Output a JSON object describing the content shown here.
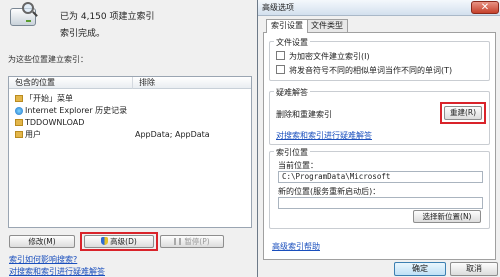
{
  "left": {
    "count_text": "已为 4,150 项建立索引",
    "status_text": "索引完成。",
    "index_caption": "为这些位置建立索引：",
    "table": {
      "col_included": "包含的位置",
      "col_excluded": "排除",
      "rows": [
        {
          "name": "「开始」菜单",
          "excluded": ""
        },
        {
          "name": "Internet Explorer 历史记录",
          "excluded": ""
        },
        {
          "name": "TDDOWNLOAD",
          "excluded": ""
        },
        {
          "name": "用户",
          "excluded": "AppData; AppData"
        }
      ]
    },
    "buttons": {
      "modify": "修改(M)",
      "advanced": "高级(D)",
      "pause": "暂停(P)"
    },
    "links": {
      "search_help": "索引如何影响搜索?",
      "troubleshoot": "对搜索和索引进行疑难解答"
    }
  },
  "dialog": {
    "title": "高级选项",
    "close_glyph": "✕",
    "tabs": [
      "索引设置",
      "文件类型"
    ],
    "file_settings": {
      "title": "文件设置",
      "options": [
        "为加密文件建立索引(I)",
        "将发音符号不同的相似单词当作不同的单词(T)"
      ]
    },
    "troubleshoot": {
      "title": "疑难解答",
      "label": "删除和重建索引",
      "rebuild": "重建(R)",
      "link": "对搜索和索引进行疑难解答"
    },
    "index_location": {
      "title": "索引位置",
      "current_label": "当前位置：",
      "current_path": "C:\\ProgramData\\Microsoft",
      "new_label": "新的位置(服务重新启动后)：",
      "new_path": "",
      "select_button": "选择新位置(N)"
    },
    "help_link": "高级索引帮助",
    "ok": "确定",
    "cancel": "取消"
  }
}
